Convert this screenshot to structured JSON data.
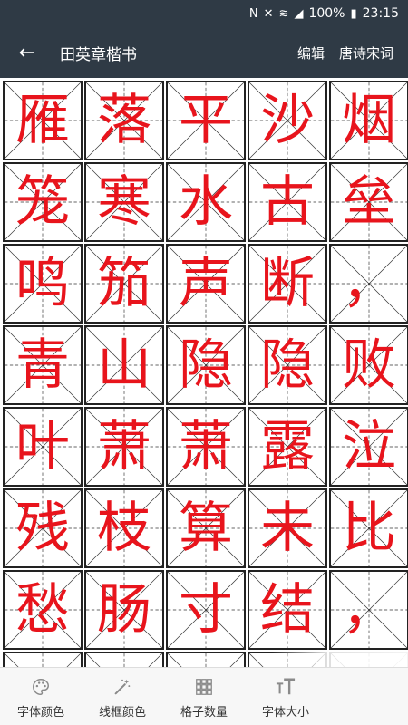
{
  "status_bar": {
    "battery": "100%",
    "time": "23:15",
    "icons": [
      "nfc-icon",
      "mute-icon",
      "wifi-icon",
      "signal-icon",
      "battery-icon"
    ]
  },
  "app_bar": {
    "back_icon": "←",
    "title": "田英章楷书",
    "edit_label": "编辑",
    "poems_label": "唐诗宋词"
  },
  "grid": {
    "font_color": "#e8141c",
    "line_color": "#222222",
    "cells": [
      "雁",
      "落",
      "平",
      "沙",
      "烟",
      "笼",
      "寒",
      "水",
      "古",
      "垒",
      "鸣",
      "笳",
      "声",
      "断",
      "，",
      "青",
      "山",
      "隐",
      "隐",
      "败",
      "叶",
      "萧",
      "萧",
      "露",
      "泣",
      "残",
      "枝",
      "算",
      "未",
      "比",
      "愁",
      "肠",
      "寸",
      "结",
      "，",
      "",
      "",
      "",
      "",
      ""
    ]
  },
  "toolbar": {
    "font_color_label": "字体颜色",
    "frame_color_label": "线框颜色",
    "grid_count_label": "格子数量",
    "font_size_label": "字体大小"
  }
}
